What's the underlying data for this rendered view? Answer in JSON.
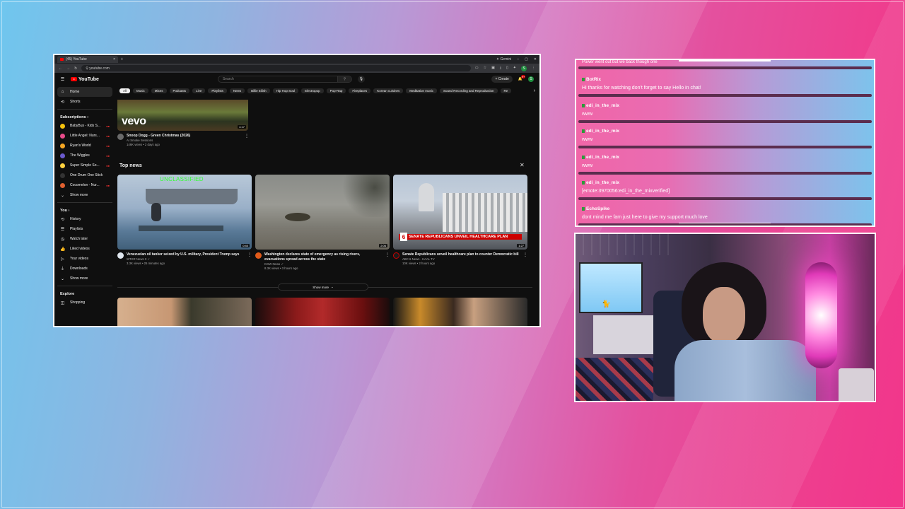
{
  "browser": {
    "tab_title": "(45) YouTube",
    "tab_close": "×",
    "new_tab": "+",
    "gemini": "✦ Gemini",
    "window_controls": [
      "–",
      "▢",
      "✕"
    ],
    "url": "youtube.com",
    "profile_initial": "S"
  },
  "youtube": {
    "logo_text": "YouTube",
    "search_placeholder": "Search",
    "create_label": "+ Create",
    "notif_count": "9+",
    "profile_initial": "S",
    "sidebar": {
      "home": "Home",
      "shorts": "Shorts",
      "subscriptions_header": "Subscriptions",
      "subscriptions": [
        {
          "name": "BabyBus - Kids S...",
          "color": "#f4c20d",
          "live": true
        },
        {
          "name": "Little Angel: Nurs...",
          "color": "#e94b8a",
          "live": true
        },
        {
          "name": "Ryan's World",
          "color": "#f5a623",
          "live": true
        },
        {
          "name": "The Wiggles",
          "color": "#6a5acd",
          "live": true
        },
        {
          "name": "Super Simple So...",
          "color": "#ffd23f",
          "live": true
        },
        {
          "name": "One Drum One Stick",
          "color": "#333333",
          "live": false
        },
        {
          "name": "Cocomelon - Nur...",
          "color": "#e06030",
          "live": true
        }
      ],
      "sub_show_more": "Show more",
      "you_header": "You",
      "you_items": [
        "History",
        "Playlists",
        "Watch later",
        "Liked videos",
        "Your videos",
        "Downloads",
        "Show more"
      ],
      "explore_header": "Explore",
      "explore_items": [
        "Shopping"
      ]
    },
    "chips": [
      "All",
      "Music",
      "Mixes",
      "Podcasts",
      "Live",
      "Playlists",
      "News",
      "Billie Eilish",
      "Hip Hop Soul",
      "Electropop",
      "Pop-Rap",
      "Fireplaces",
      "Korean cuisines",
      "Meditation music",
      "Sound Recording and Reproduction",
      "Re"
    ],
    "top_video": {
      "thumb_text": "vevo",
      "duration": "4:17",
      "title": "Snoop Dogg - Green Christmas (2026)",
      "channel": "AI Smoke Sessions",
      "meta": "146K views • 2 days ago"
    },
    "top_news_label": "Top news",
    "news": [
      {
        "title": "Venezuelan oil tanker seized by U.S. military, President Trump says",
        "channel": "WTKR News 3 ✓",
        "meta": "3.3K views • 25 minutes ago",
        "duration": "0:40",
        "overlay": "UNCLASSIFIED"
      },
      {
        "title": "Washington declares state of emergency as rising rivers, evacuations spread across the state",
        "channel": "KGW News ✓",
        "meta": "8.3K views • 3 hours ago",
        "duration": "2:06"
      },
      {
        "title": "Senate Republicans unveil healthcare plan to counter Democratic bill",
        "channel": "ABC 6 News - KAAL TV",
        "meta": "10K views • 2 hours ago",
        "duration": "1:27",
        "lower_third": "SENATE REPUBLICANS UNVEIL HEALTHCARE PLAN",
        "station": "6"
      }
    ],
    "show_more": "Show more"
  },
  "chat": {
    "top_partial": "Power went out but we back though one",
    "messages": [
      {
        "user": "BotRix",
        "text": "Hi thanks for watching don't forget to say Hello in chat!"
      },
      {
        "user": "edi_in_the_mix",
        "text": "www"
      },
      {
        "user": "edi_in_the_mix",
        "text": "www"
      },
      {
        "user": "edi_in_the_mix",
        "text": "www"
      },
      {
        "user": "edi_in_the_mix",
        "text": "[emote:3970056:edi_in_the_mixverified]"
      },
      {
        "user": "EchoSpike",
        "text": "dont mind me fam just here to give my support much love"
      }
    ]
  },
  "colors": {
    "yt_bg": "#0f0f0f",
    "yt_red": "#ff0000",
    "chat_bar": "#5b2d4e",
    "sub_badge": "#2c9a3a"
  }
}
